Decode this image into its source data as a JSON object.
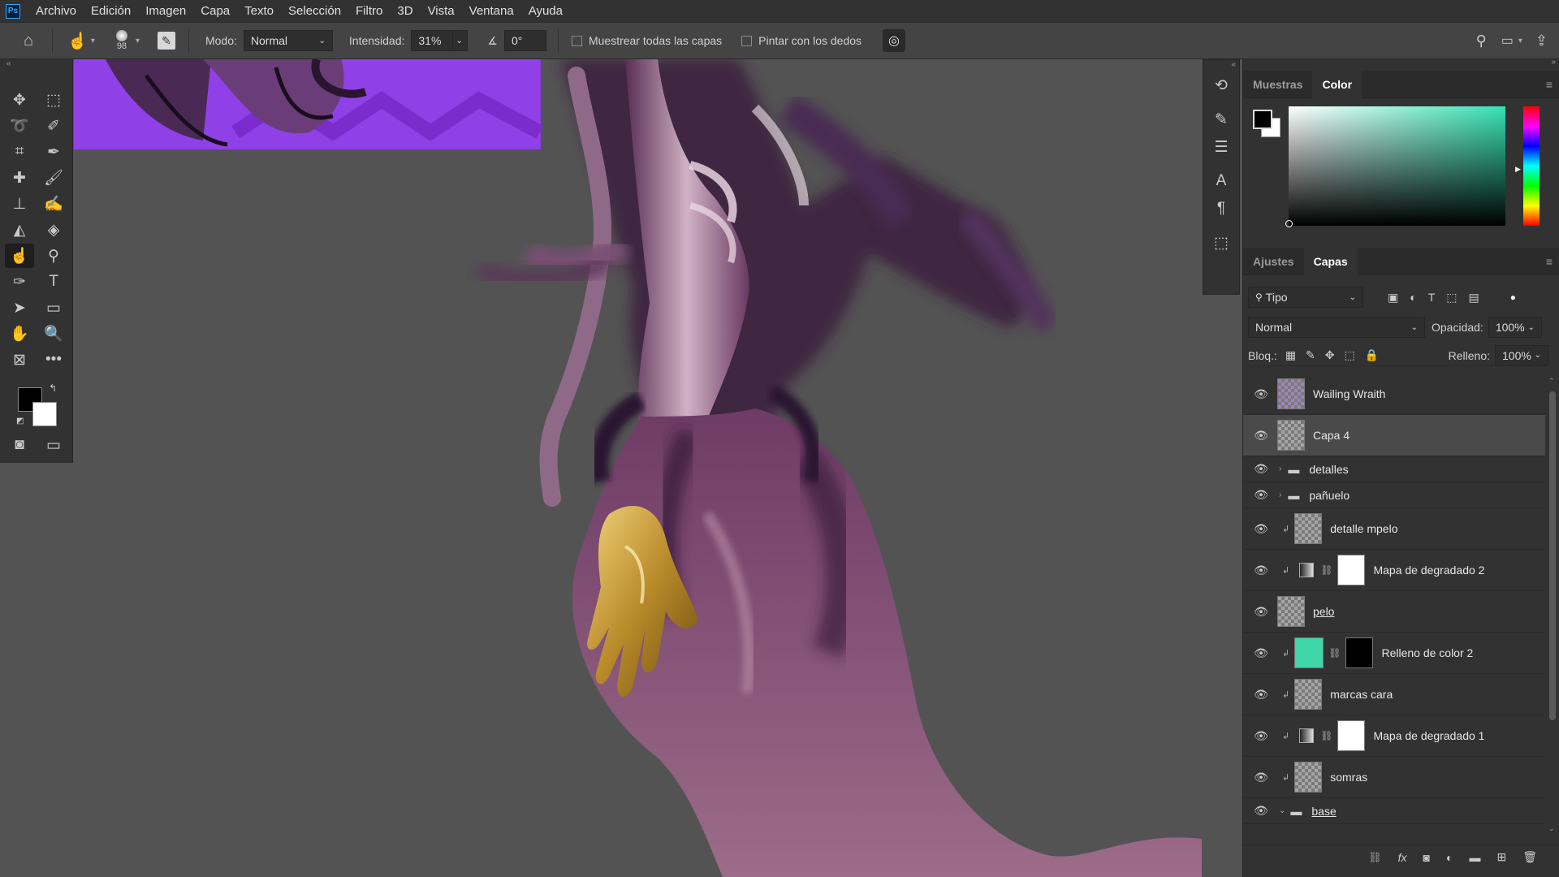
{
  "app": {
    "logo": "Ps"
  },
  "menu": [
    "Archivo",
    "Edición",
    "Imagen",
    "Capa",
    "Texto",
    "Selección",
    "Filtro",
    "3D",
    "Vista",
    "Ventana",
    "Ayuda"
  ],
  "options": {
    "brush_size": "98",
    "mode_label": "Modo:",
    "mode_value": "Normal",
    "intensity_label": "Intensidad:",
    "intensity_value": "31%",
    "angle_value": "0°",
    "sample_all_label": "Muestrear todas las capas",
    "finger_paint_label": "Pintar con los dedos"
  },
  "color_panel": {
    "tabs": [
      "Muestras",
      "Color"
    ],
    "active_tab": "Color",
    "foreground": "#000000",
    "background": "#ffffff",
    "hue_color": "#36e2b4"
  },
  "layers_panel": {
    "tabs": [
      "Ajustes",
      "Capas"
    ],
    "active_tab": "Capas",
    "filter_value": "Tipo",
    "blend_mode": "Normal",
    "opacity_label": "Opacidad:",
    "opacity_value": "100%",
    "lock_label": "Bloq.:",
    "fill_label": "Relleno:",
    "fill_value": "100%",
    "layers": [
      {
        "name": "Wailing Wraith",
        "kind": "smart",
        "selected": false
      },
      {
        "name": "Capa 4",
        "kind": "pixel",
        "selected": true
      },
      {
        "name": "detalles",
        "kind": "group",
        "selected": false
      },
      {
        "name": "pañuelo",
        "kind": "group",
        "selected": false
      },
      {
        "name": "detalle mpelo",
        "kind": "clipped",
        "selected": false
      },
      {
        "name": "Mapa de degradado 2",
        "kind": "adjustment",
        "selected": false
      },
      {
        "name": "pelo",
        "kind": "pixel-underlined",
        "selected": false
      },
      {
        "name": "Relleno de color 2",
        "kind": "fill",
        "selected": false,
        "fill_color": "#3fd6a8"
      },
      {
        "name": "marcas cara",
        "kind": "clipped",
        "selected": false
      },
      {
        "name": "Mapa de degradado 1",
        "kind": "adjustment",
        "selected": false
      },
      {
        "name": "somras",
        "kind": "clipped",
        "selected": false
      },
      {
        "name": "base",
        "kind": "group-open",
        "selected": false
      }
    ]
  },
  "colors": {
    "accent_purple": "#8a3ae0",
    "canvas_gray": "#535353"
  }
}
